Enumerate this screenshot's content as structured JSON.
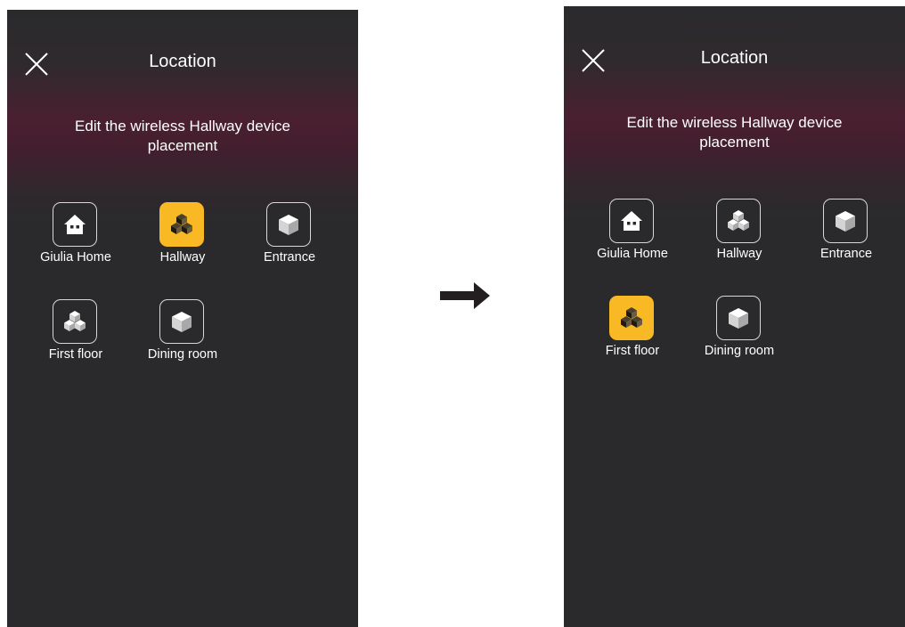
{
  "transition_arrow_icon": "right-arrow-icon",
  "accent_color": "#f9b925",
  "before": {
    "header": {
      "title": "Location",
      "close_icon": "close-icon"
    },
    "subtitle": "Edit the wireless Hallway device placement",
    "locations": [
      {
        "label": "Giulia Home",
        "icon": "house-icon",
        "selected": false
      },
      {
        "label": "Hallway",
        "icon": "cubes-icon",
        "selected": true
      },
      {
        "label": "Entrance",
        "icon": "cube-icon",
        "selected": false
      },
      {
        "label": "First floor",
        "icon": "cubes-icon",
        "selected": false
      },
      {
        "label": "Dining room",
        "icon": "cube-icon",
        "selected": false
      }
    ]
  },
  "after": {
    "header": {
      "title": "Location",
      "close_icon": "close-icon"
    },
    "subtitle": "Edit the wireless Hallway device placement",
    "locations": [
      {
        "label": "Giulia Home",
        "icon": "house-icon",
        "selected": false
      },
      {
        "label": "Hallway",
        "icon": "cubes-icon",
        "selected": false
      },
      {
        "label": "Entrance",
        "icon": "cube-icon",
        "selected": false
      },
      {
        "label": "First floor",
        "icon": "cubes-icon",
        "selected": true
      },
      {
        "label": "Dining room",
        "icon": "cube-icon",
        "selected": false
      }
    ]
  }
}
